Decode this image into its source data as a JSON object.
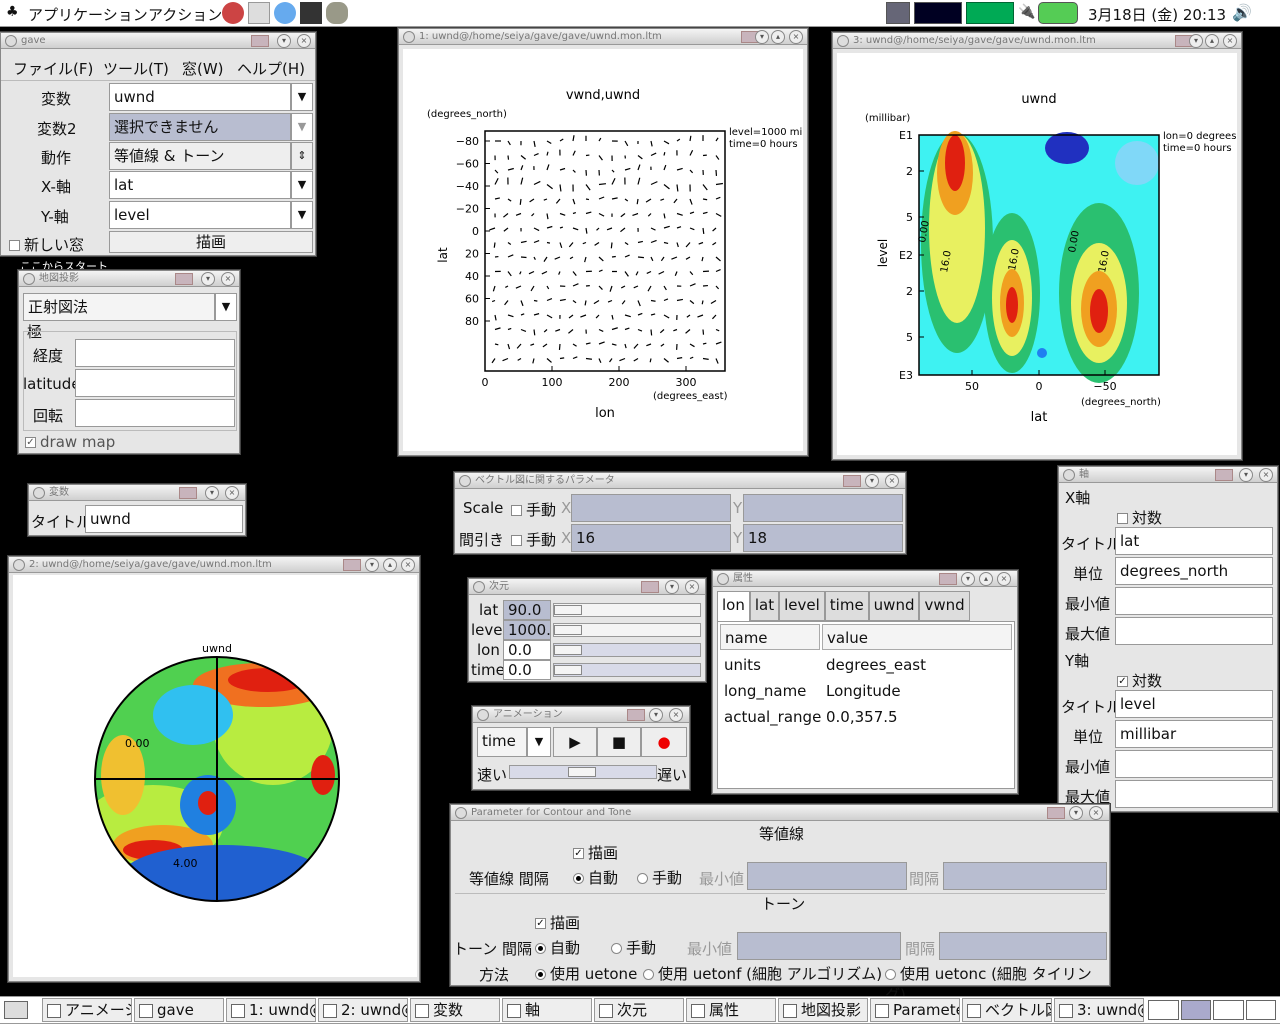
{
  "top_panel": {
    "apps": "アプリケーション",
    "actions": "アクション",
    "clock": "3月18日 (金) 20:13"
  },
  "gave_win": {
    "title": "gave",
    "menu": [
      "ファイル(F)",
      "ツール(T)",
      "窓(W)",
      "ヘルプ(H)"
    ],
    "var_label": "変数",
    "var_value": "uwnd",
    "var2_label": "変数2",
    "var2_value": "選択できません",
    "action_label": "動作",
    "action_value": "等値線 & トーン",
    "x_label": "X-軸",
    "x_value": "lat",
    "y_label": "Y-軸",
    "y_value": "level",
    "new_win": "新しい窓",
    "draw": "描画"
  },
  "start_label": "ここからスタート",
  "proj_win": {
    "title": "地図投影",
    "value": "正射図法",
    "pole": "極",
    "lon": "経度",
    "lat": "latitude",
    "rot": "回転",
    "draw_map": "draw map"
  },
  "var_win": {
    "title": "変数",
    "label": "タイトル",
    "value": "uwnd"
  },
  "plot1": {
    "title": "1: uwnd@/home/seiya/gave/gave/uwnd.mon.ltm",
    "heading": "vwnd,uwnd",
    "yunit": "(degrees_north)",
    "ylabel": "lat",
    "xlabel": "lon",
    "xunit": "(degrees_east)",
    "note1": "level=1000 mi",
    "note2": "time=0 hours",
    "yticks": [
      "−80",
      "−60",
      "−40",
      "−20",
      "0",
      "20",
      "40",
      "60",
      "80"
    ],
    "xticks": [
      "0",
      "100",
      "200",
      "300"
    ]
  },
  "plot3": {
    "title": "3: uwnd@/home/seiya/gave/gave/uwnd.mon.ltm",
    "heading": "uwnd",
    "yunit": "(millibar)",
    "ylabel": "level",
    "xlabel": "lat",
    "xunit": "(degrees_north)",
    "note1": "lon=0 degrees",
    "note2": "time=0 hours",
    "yticks": [
      "E1",
      "2",
      "5",
      "E2",
      "2",
      "5",
      "E3"
    ],
    "xticks": [
      "50",
      "0",
      "−50"
    ],
    "contours": [
      "0.00",
      "16.0",
      "16.0",
      "0.00",
      "16.0"
    ]
  },
  "plot2": {
    "title": "2: uwnd@/home/seiya/gave/gave/uwnd.mon.ltm",
    "heading": "uwnd",
    "labels": [
      "0.00",
      "4.00"
    ]
  },
  "vec_win": {
    "title": "ベクトル図に関するパラメータ",
    "scale": "Scale",
    "thin": "間引き",
    "manual": "手動",
    "x": "X",
    "y": "Y",
    "thin_x": "16",
    "thin_y": "18"
  },
  "dim_win": {
    "title": "次元",
    "rows": [
      {
        "name": "lat",
        "value": "90.0"
      },
      {
        "name": "leve",
        "value": "1000.("
      },
      {
        "name": "lon",
        "value": "0.0"
      },
      {
        "name": "time",
        "value": "0.0"
      }
    ]
  },
  "attr_win": {
    "title": "属性",
    "tabs": [
      "lon",
      "lat",
      "level",
      "time",
      "uwnd",
      "vwnd"
    ],
    "headers": [
      "name",
      "value"
    ],
    "rows": [
      [
        "units",
        "degrees_east"
      ],
      [
        "long_name",
        "Longitude"
      ],
      [
        "actual_range",
        "0.0,357.5"
      ]
    ]
  },
  "anim_win": {
    "title": "アニメーション",
    "select": "time",
    "fast": "速い",
    "slow": "遅い"
  },
  "axis_win": {
    "title": "軸",
    "x_head": "X軸",
    "y_head": "Y軸",
    "log": "対数",
    "title_lbl": "タイトル",
    "unit_lbl": "単位",
    "min_lbl": "最小値",
    "max_lbl": "最大値",
    "x_title": "lat",
    "x_unit": "degrees_north",
    "y_title": "level",
    "y_unit": "millibar"
  },
  "cont_win": {
    "title": "Parameter for Contour and Tone",
    "contour_head": "等値線",
    "draw": "描画",
    "c_interval": "等値線 間隔",
    "auto": "自動",
    "manual": "手動",
    "min": "最小値",
    "int": "間隔",
    "tone_head": "トーン",
    "t_interval": "トーン 間隔",
    "method": "方法",
    "m1": "使用 uetone",
    "m2": "使用 uetonf (細胞 アルゴリズム)",
    "m3": "使用 uetonc (細胞 タイリング)"
  },
  "taskbar": [
    "アニメーシ",
    "gave",
    "1: uwnd@",
    "2: uwnd@",
    "変数",
    "軸",
    "次元",
    "属性",
    "地図投影",
    "Paramete",
    "ベクトル図",
    "3: uwnd@"
  ]
}
